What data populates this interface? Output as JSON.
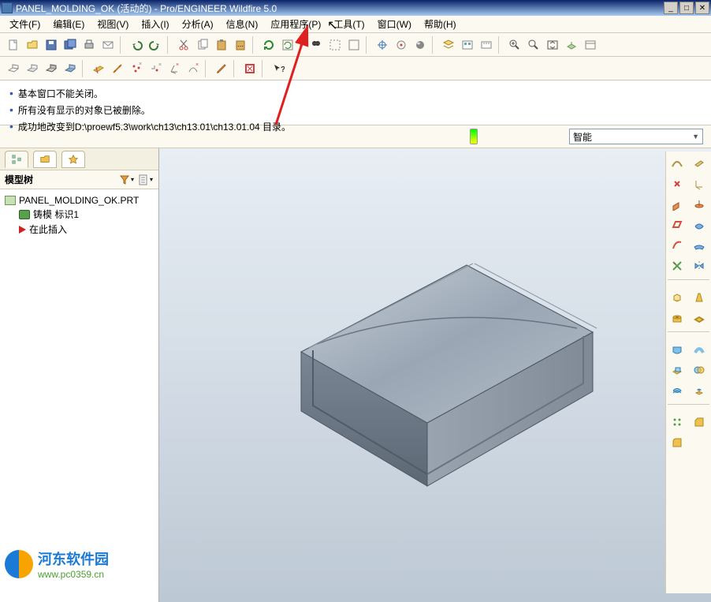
{
  "title": "PANEL_MOLDING_OK (活动的) - Pro/ENGINEER Wildfire 5.0",
  "menu": {
    "file": "文件(F)",
    "edit": "编辑(E)",
    "view": "视图(V)",
    "insert": "插入(I)",
    "analyze": "分析(A)",
    "info": "信息(N)",
    "apps": "应用程序(P)",
    "tools": "工具(T)",
    "window": "窗口(W)",
    "help": "帮助(H)"
  },
  "messages": {
    "m1": "基本窗口不能关闭。",
    "m2": "所有没有显示的对象已被删除。",
    "m3": "成功地改变到D:\\proewf5.3\\work\\ch13\\ch13.01\\ch13.01.04 目录。"
  },
  "subbar": {
    "dropdown": "智能"
  },
  "sidebar": {
    "panel_title": "模型树",
    "root": "PANEL_MOLDING_OK.PRT",
    "feat1": "铸模 标识1",
    "insert": "在此插入"
  },
  "watermark": {
    "line1": "河东软件园",
    "line2": "www.pc0359.cn"
  },
  "icons": {
    "new": "新建",
    "open": "打开",
    "save": "保存",
    "savecopy": "另存",
    "print": "打印",
    "undo": "撤销",
    "redo": "重做",
    "cut": "剪切",
    "copy": "复制",
    "paste": "粘贴",
    "regen": "再生",
    "find": "查找",
    "sel": "选择",
    "box": "框选",
    "centerD": "基准",
    "pln": "平面",
    "axis": "轴",
    "pt": "点",
    "csys": "坐标系",
    "layers": "层",
    "mapkey": "映射",
    "zoomfit": "缩放到全部",
    "zoomin": "放大",
    "zoomout": "缩小",
    "refit": "重新调整",
    "orient": "方向",
    "saved": "保存视图"
  }
}
